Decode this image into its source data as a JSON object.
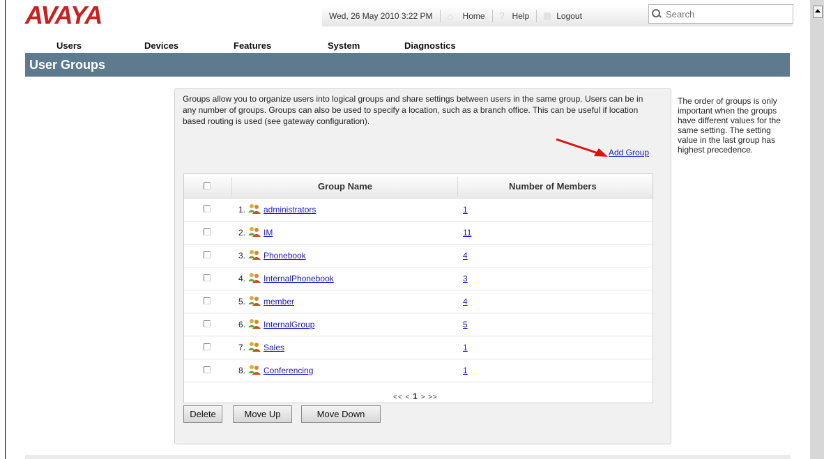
{
  "header": {
    "logo_text": "AVAYA",
    "datetime": "Wed, 26 May 2010 3:22 PM",
    "home_label": "Home",
    "help_label": "Help",
    "logout_label": "Logout",
    "search_placeholder": "Search"
  },
  "nav": {
    "items": [
      {
        "label": "Users"
      },
      {
        "label": "Devices"
      },
      {
        "label": "Features"
      },
      {
        "label": "System"
      },
      {
        "label": "Diagnostics"
      }
    ]
  },
  "page": {
    "title": "User Groups",
    "description": "Groups allow you to organize users into logical groups and share settings between users in the same group. Users can be in any number of groups. Groups can also be used to specify a location, such as a branch office. This can be useful if location based routing is used (see gateway configuration).",
    "add_group_label": "Add Group",
    "side_note": "The order of groups is only important when the groups have different values for the same setting. The setting value in the last group has highest precedence."
  },
  "table": {
    "headers": {
      "name": "Group Name",
      "members": "Number of Members"
    },
    "rows": [
      {
        "index": "1.",
        "name": "administrators",
        "members": "1"
      },
      {
        "index": "2.",
        "name": "IM",
        "members": "11"
      },
      {
        "index": "3.",
        "name": "Phonebook",
        "members": "4"
      },
      {
        "index": "4.",
        "name": "InternalPhonebook",
        "members": "3"
      },
      {
        "index": "5.",
        "name": "member",
        "members": "4"
      },
      {
        "index": "6.",
        "name": "InternalGroup",
        "members": "5"
      },
      {
        "index": "7.",
        "name": "Sales",
        "members": "1"
      },
      {
        "index": "8.",
        "name": "Conferencing",
        "members": "1"
      }
    ],
    "pager": {
      "first": "<<",
      "prev": "<",
      "current": "1",
      "next": ">",
      "last": ">>"
    }
  },
  "buttons": {
    "delete": "Delete",
    "move_up": "Move Up",
    "move_down": "Move Down"
  },
  "colors": {
    "brand_red": "#cc1f1f",
    "title_bar": "#5d7a8f",
    "link": "#1a1acc",
    "arrow": "#e01010"
  }
}
